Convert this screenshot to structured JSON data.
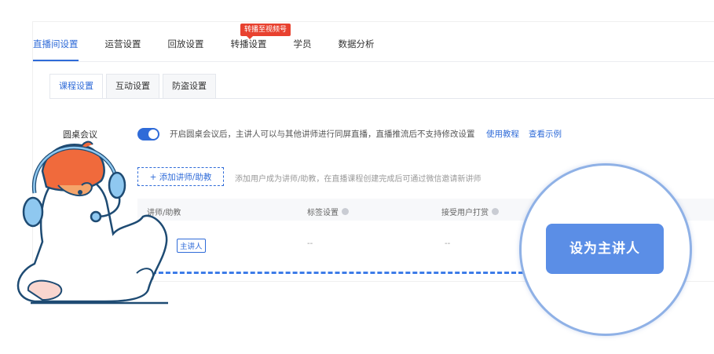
{
  "header": {
    "tabs": [
      {
        "label": "直播间设置",
        "active": true
      },
      {
        "label": "运营设置"
      },
      {
        "label": "回放设置"
      },
      {
        "label": "转播设置"
      },
      {
        "label": "学员"
      },
      {
        "label": "数据分析"
      }
    ],
    "badge": "转播至视频号"
  },
  "sub_tabs": [
    {
      "label": "课程设置",
      "active": true
    },
    {
      "label": "互动设置"
    },
    {
      "label": "防盗设置"
    }
  ],
  "roundtable": {
    "label": "圆桌会议",
    "enabled": true,
    "description": "开启圆桌会议后，主讲人可以与其他讲师进行同屏直播，直播推流后不支持修改设置",
    "link_tutorial": "使用教程",
    "link_example": "查看示例"
  },
  "add_lecturer": {
    "button_label": "+ 添加讲师/助教",
    "description": "添加用户成为讲师/助教，在直播课程创建完成后可通过微信邀请新讲师"
  },
  "table": {
    "columns": [
      "讲师/助教",
      "标签设置",
      "接受用户打赏"
    ],
    "rows": [
      {
        "role_badge": "主讲人",
        "tag": "--",
        "reward": "--"
      }
    ]
  },
  "callout": {
    "button_label": "设为主讲人"
  },
  "colors": {
    "accent": "#2f6bd8",
    "callout_button": "#5b8ee6",
    "badge": "#e8412f"
  }
}
